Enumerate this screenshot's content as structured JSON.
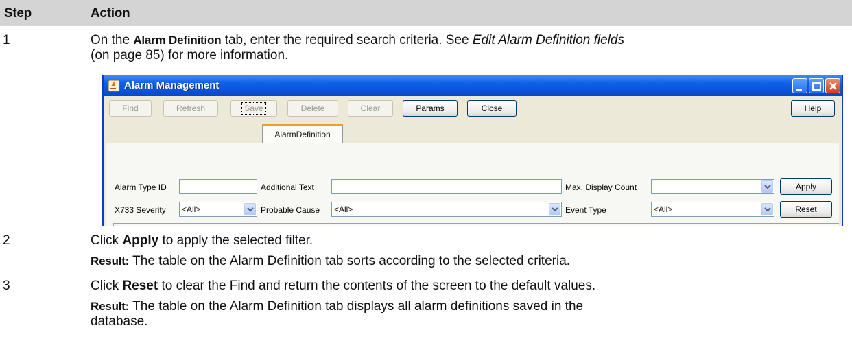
{
  "table": {
    "header": {
      "step": "Step",
      "action": "Action"
    }
  },
  "steps": [
    {
      "number": "1",
      "text_a": "On the ",
      "bold_a": "Alarm Definition",
      "text_b": " tab, enter the required search criteria. See ",
      "italic_a": "Edit Alarm Definition fields",
      "text_c": "(on page 85) for more information."
    },
    {
      "number": "2",
      "text_a": "Click ",
      "bold_a": "Apply",
      "text_b": " to apply the selected filter.",
      "result_label": "Result:",
      "result_text": " The table on the Alarm Definition tab sorts according to the selected criteria."
    },
    {
      "number": "3",
      "text_a": "Click ",
      "bold_a": "Reset",
      "text_b": " to clear the Find and return the contents of the screen to the default values.",
      "result_label": "Result:",
      "result_text_1": " The table on the Alarm Definition tab displays all alarm definitions saved in the",
      "result_text_2": "database."
    }
  ],
  "window": {
    "title": "Alarm Management",
    "icons": {
      "app": "java-cup-icon",
      "minimize": "minimize-icon",
      "maximize": "maximize-icon",
      "close": "close-icon"
    },
    "toolbar": {
      "find": "Find",
      "refresh": "Refresh",
      "save": "Save",
      "delete": "Delete",
      "clear": "Clear",
      "params": "Params",
      "close": "Close",
      "help": "Help"
    },
    "tab": "AlarmDefinition",
    "filters": {
      "alarm_type_id_label": "Alarm Type ID",
      "alarm_type_id_value": "",
      "additional_text_label": "Additional Text",
      "additional_text_value": "",
      "max_display_count_label": "Max. Display Count",
      "max_display_count_value": "",
      "apply": "Apply",
      "x733_severity_label": "X733 Severity",
      "x733_severity_value": "<All>",
      "probable_cause_label": "Probable Cause",
      "probable_cause_value": "<All>",
      "event_type_label": "Event Type",
      "event_type_value": "<All>",
      "reset": "Reset"
    }
  }
}
